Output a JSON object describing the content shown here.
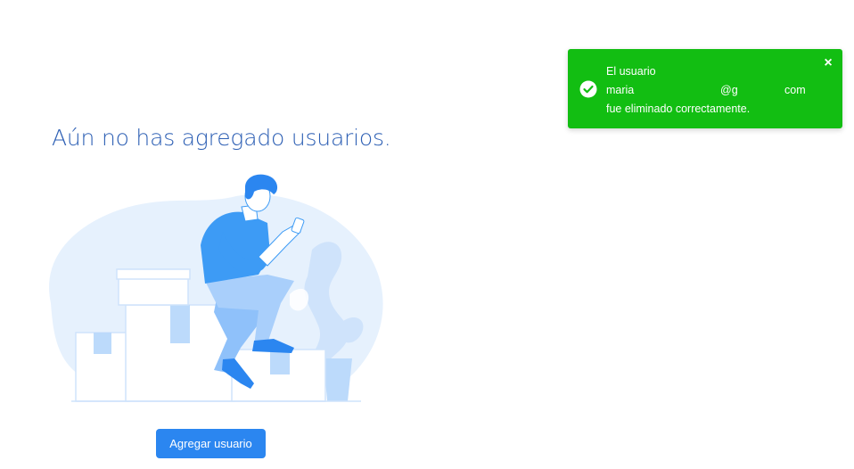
{
  "empty_state": {
    "title": "Aún no has agregado usuarios.",
    "add_button_label": "Agregar usuario"
  },
  "toast": {
    "type": "success",
    "color": "#12be12",
    "icon": "check-circle-icon",
    "close_icon": "close-icon",
    "close_glyph": "×",
    "line1": "El usuario",
    "email_user": "maria",
    "email_domain": "@g",
    "email_tld": "com",
    "line3": "fue eliminado correctamente."
  },
  "colors": {
    "title": "#2d5fb4",
    "button": "#2b86f0",
    "illustration_primary": "#3d9bf5",
    "illustration_light": "#e6f1fd"
  }
}
